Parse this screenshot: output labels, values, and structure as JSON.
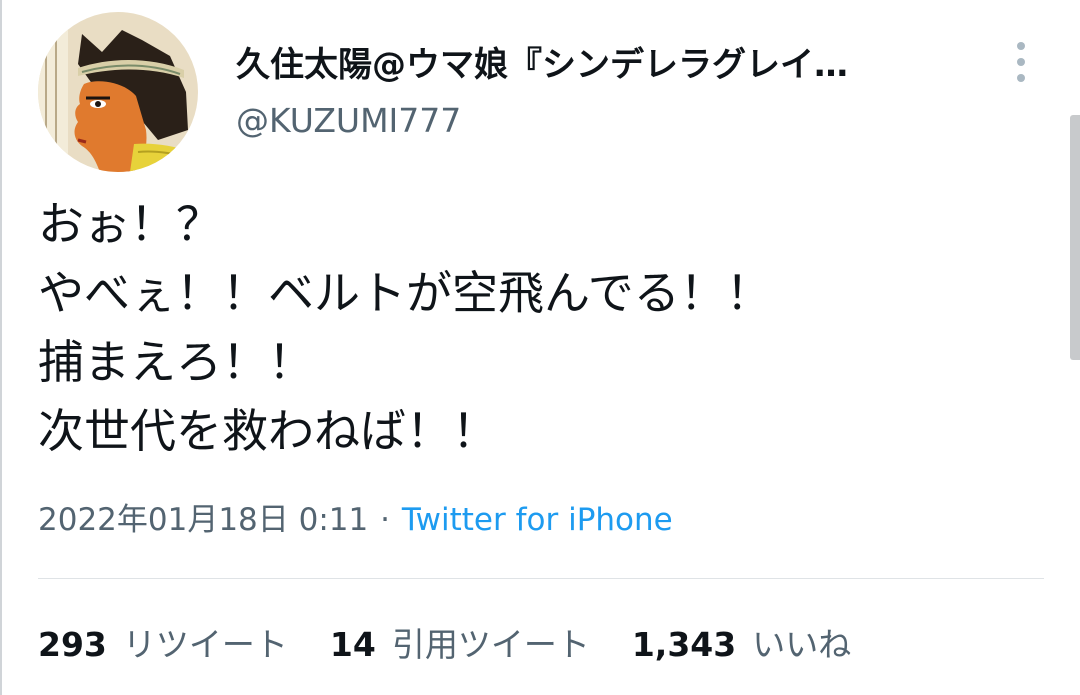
{
  "tweet": {
    "author": {
      "display_name": "久住太陽@ウマ娘『シンデレラグレイ…",
      "handle": "@KUZUMI777",
      "avatar_icon": "avatar-egyptian-profile-icon"
    },
    "more_icon": "more-vertical-icon",
    "text_lines": [
      "おぉ！？",
      "やべぇ！！ベルトが空飛んでる！！",
      "捕まえろ！！",
      "次世代を救わねば！！"
    ],
    "meta": {
      "timestamp": "2022年01月18日 0:11",
      "separator": "·",
      "source": "Twitter for iPhone"
    },
    "stats": {
      "retweets": {
        "count": "293",
        "label": "リツイート"
      },
      "quotes": {
        "count": "14",
        "label": "引用ツイート"
      },
      "likes": {
        "count": "1,343",
        "label": "いいね"
      }
    }
  },
  "colors": {
    "text_primary": "#0f1419",
    "text_secondary": "#536471",
    "link": "#1d9bf0",
    "divider": "#dfe3e6"
  }
}
